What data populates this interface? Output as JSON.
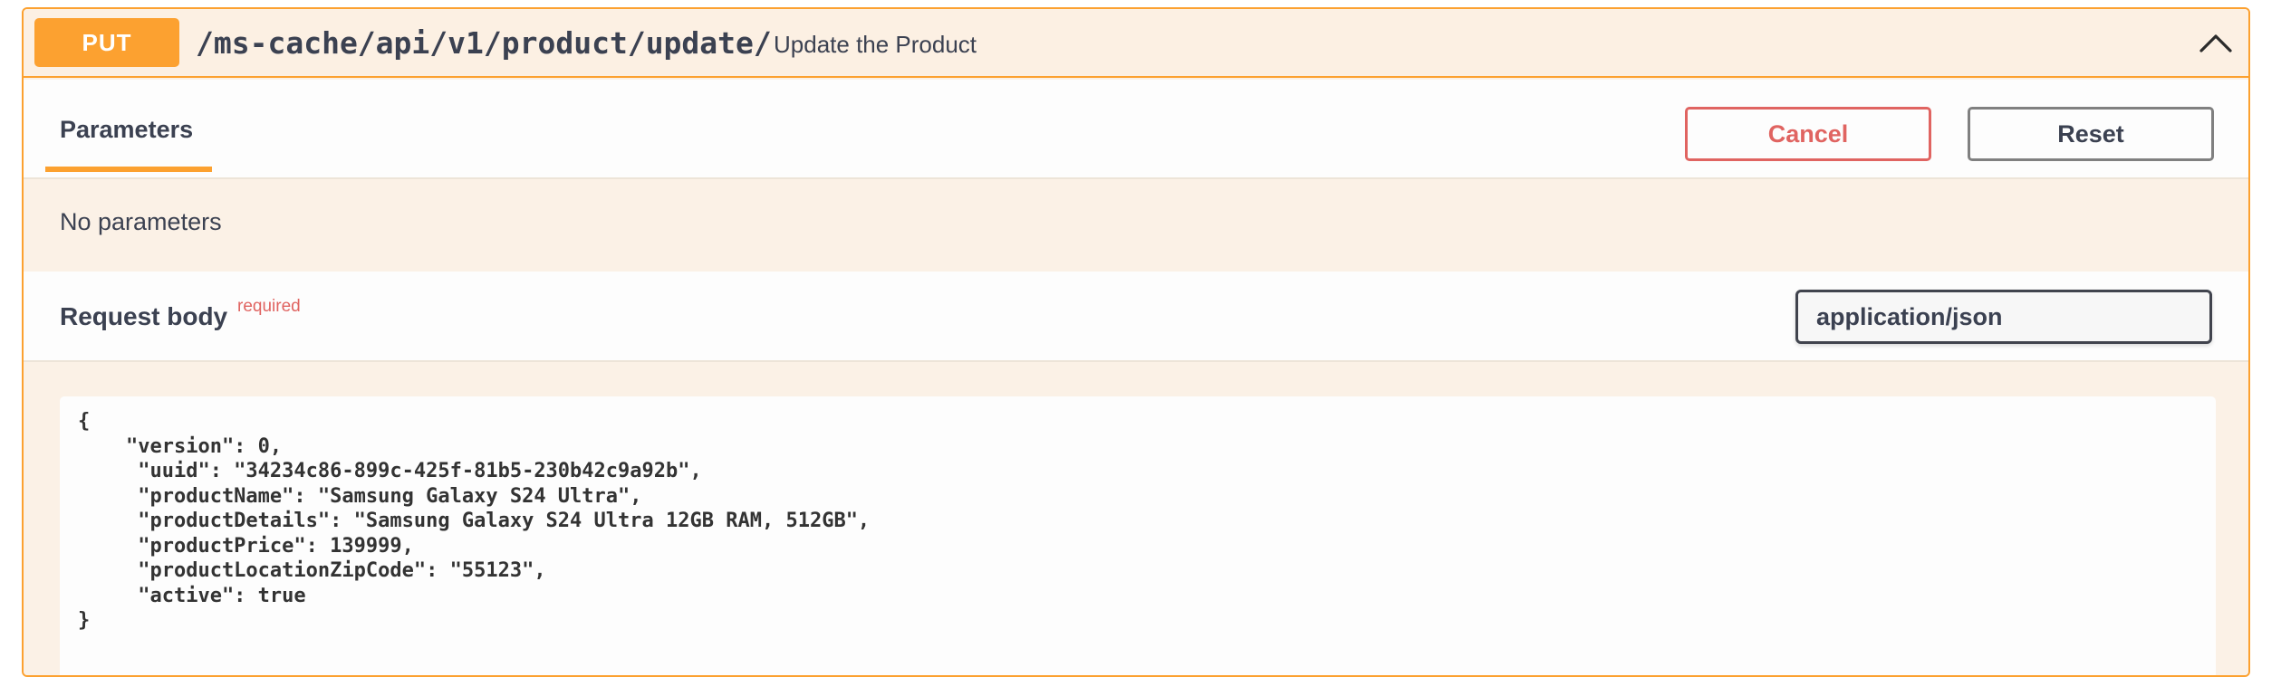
{
  "operation": {
    "method": "PUT",
    "path": "/ms-cache/api/v1/product/update/",
    "description": "Update the Product",
    "toggle_icon": "chevron-up-icon"
  },
  "tabs": {
    "parameters_label": "Parameters"
  },
  "actions": {
    "cancel_label": "Cancel",
    "reset_label": "Reset"
  },
  "parameters": {
    "empty_text": "No parameters"
  },
  "request_body": {
    "title": "Request body",
    "required_label": "required",
    "content_type": "application/json",
    "json_text": "{\n    \"version\": 0,\n     \"uuid\": \"34234c86-899c-425f-81b5-230b42c9a92b\",\n     \"productName\": \"Samsung Galaxy S24 Ultra\",\n     \"productDetails\": \"Samsung Galaxy S24 Ultra 12GB RAM, 512GB\",\n     \"productPrice\": 139999,\n     \"productLocationZipCode\": \"55123\",\n     \"active\": true\n}"
  },
  "colors": {
    "put_accent": "#fca130",
    "cancel_red": "#e06461",
    "text": "#3b4151"
  }
}
